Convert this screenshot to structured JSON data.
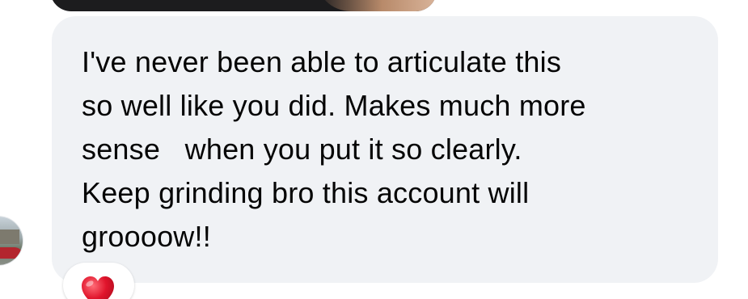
{
  "previous_attachment": {
    "icon": "image-thumbnail"
  },
  "sender": {
    "avatar_icon": "avatar-photo"
  },
  "message": {
    "lines": [
      "I've never been able to articulate this",
      "so well like you did. Makes much more",
      "sense   when you put it so clearly.",
      "Keep grinding bro this account will",
      "groooow!!"
    ],
    "bubble_color": "#f0f2f5",
    "text_color": "#050505"
  },
  "reaction": {
    "icon": "red-heart-icon",
    "color": "#e0142b"
  }
}
